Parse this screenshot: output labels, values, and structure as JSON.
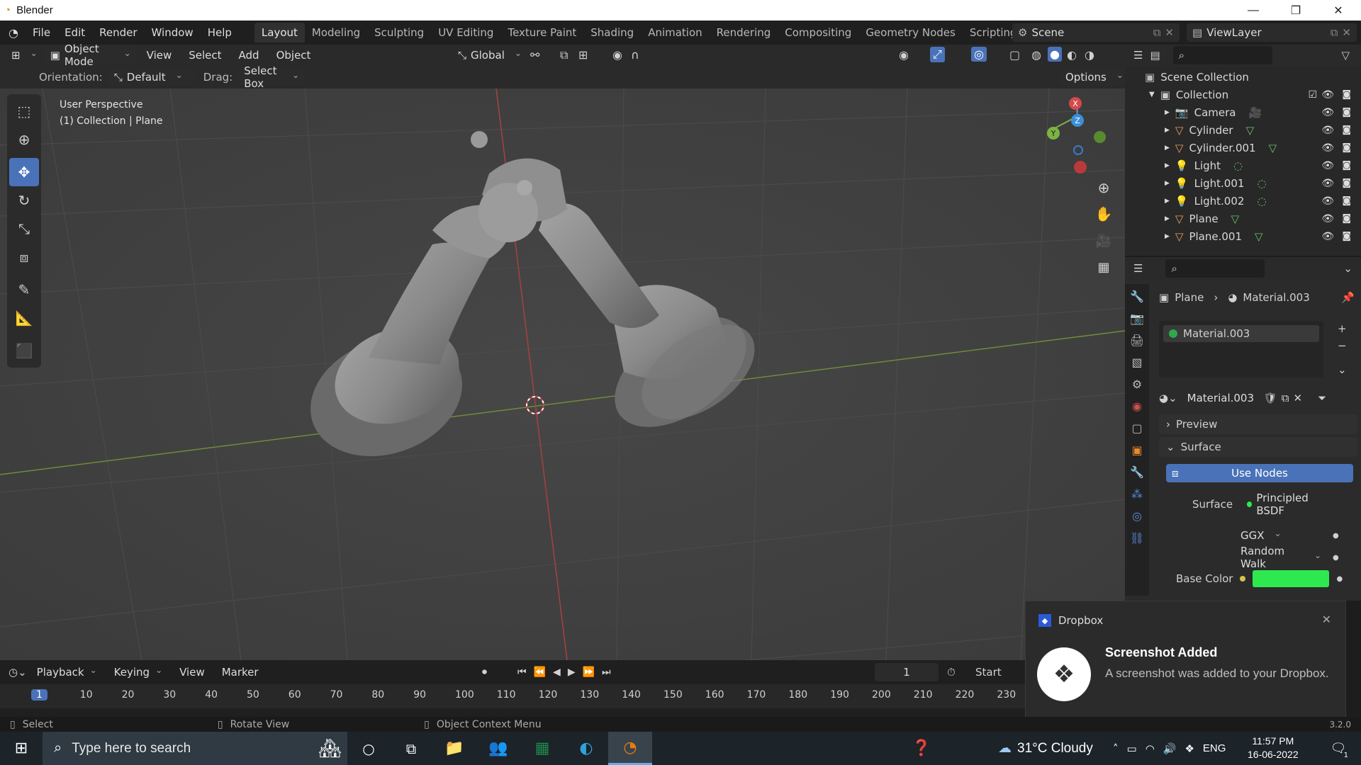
{
  "window": {
    "app_title": "Blender",
    "minimize": "—",
    "maximize": "❐",
    "close": "✕"
  },
  "menu": [
    "File",
    "Edit",
    "Render",
    "Window",
    "Help"
  ],
  "workspaces": [
    "Layout",
    "Modeling",
    "Sculpting",
    "UV Editing",
    "Texture Paint",
    "Shading",
    "Animation",
    "Rendering",
    "Compositing",
    "Geometry Nodes",
    "Scripting"
  ],
  "workspace_active": "Layout",
  "scene": {
    "name": "Scene",
    "view_layer": "ViewLayer"
  },
  "viewport_header": {
    "mode": "Object Mode",
    "menus": [
      "View",
      "Select",
      "Add",
      "Object"
    ],
    "transform": "Global"
  },
  "tool_header": {
    "orientation_label": "Orientation:",
    "orientation_value": "Default",
    "drag_label": "Drag:",
    "drag_value": "Select Box",
    "options": "Options"
  },
  "viewport": {
    "perspective": "User Perspective",
    "context": "(1) Collection | Plane"
  },
  "gizmo": {
    "x": "X",
    "y": "Y",
    "z": "Z"
  },
  "outliner": {
    "scene_collection": "Scene Collection",
    "collection": "Collection",
    "items": [
      {
        "name": "Camera",
        "icon": "camera-icon"
      },
      {
        "name": "Cylinder",
        "icon": "mesh-icon"
      },
      {
        "name": "Cylinder.001",
        "icon": "mesh-icon"
      },
      {
        "name": "Light",
        "icon": "light-icon"
      },
      {
        "name": "Light.001",
        "icon": "light-icon"
      },
      {
        "name": "Light.002",
        "icon": "light-icon"
      },
      {
        "name": "Plane",
        "icon": "mesh-icon"
      },
      {
        "name": "Plane.001",
        "icon": "mesh-icon"
      }
    ]
  },
  "properties": {
    "breadcrumb_object": "Plane",
    "breadcrumb_material": "Material.003",
    "slot": "Material.003",
    "material_name": "Material.003",
    "panel_preview": "Preview",
    "panel_surface": "Surface",
    "use_nodes": "Use Nodes",
    "surface_label": "Surface",
    "surface_value": "Principled BSDF",
    "distribution": "GGX",
    "subsurface_method": "Random Walk",
    "base_color_label": "Base Color",
    "base_color": "#2ee84f",
    "version": "3.2.0"
  },
  "timeline": {
    "menus": [
      "Playback",
      "Keying",
      "View",
      "Marker"
    ],
    "current_frame": "1",
    "start_label": "Start",
    "ticks": [
      "1",
      "10",
      "20",
      "30",
      "40",
      "50",
      "60",
      "70",
      "80",
      "90",
      "100",
      "110",
      "120",
      "130",
      "140",
      "150",
      "160",
      "170",
      "180",
      "190",
      "200",
      "210",
      "220",
      "230"
    ]
  },
  "statusbar": {
    "select": "Select",
    "rotate": "Rotate View",
    "context_menu": "Object Context Menu"
  },
  "toast": {
    "app": "Dropbox",
    "title": "Screenshot Added",
    "body": "A screenshot was added to your Dropbox."
  },
  "taskbar": {
    "search_placeholder": "Type here to search",
    "weather": "31°C  Cloudy",
    "language": "ENG",
    "time": "11:57 PM",
    "date": "16-06-2022",
    "notification_count": "1"
  },
  "colors": {
    "accent": "#4a72b8",
    "axis_x": "#d44a4a",
    "axis_y": "#7cb342",
    "axis_z": "#3a8fd8"
  }
}
